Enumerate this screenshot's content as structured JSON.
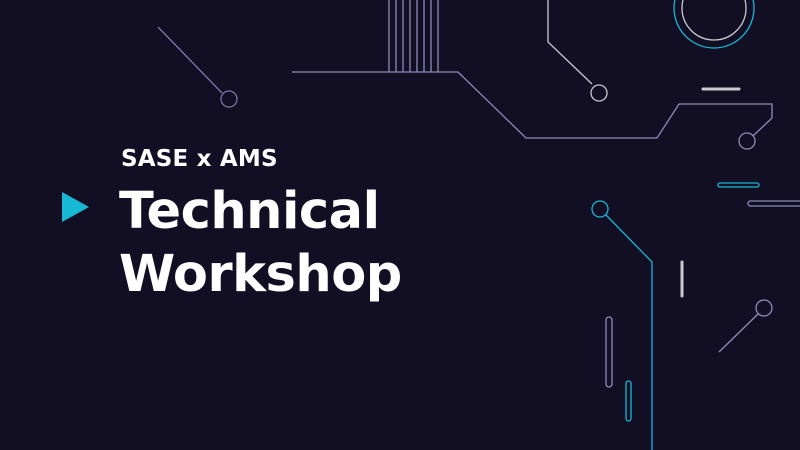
{
  "slide": {
    "subtitle": "SASE x AMS",
    "title_lines": [
      "Technical",
      "Workshop"
    ],
    "marker_icon": "play-triangle-icon"
  },
  "colors": {
    "background": "#120f24",
    "text": "#ffffff",
    "accent_cyan": "#16b8d6",
    "circuit_lavender": "#8b86b3",
    "circuit_grey": "#c9c9cf"
  }
}
